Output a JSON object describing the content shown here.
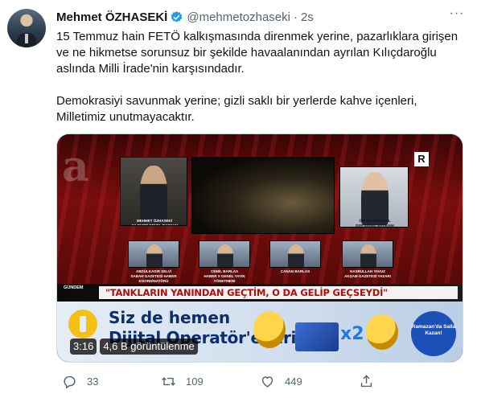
{
  "tweet": {
    "author_name": "Mehmet ÖZHASEKİ",
    "author_handle": "@mehmetozhaseki",
    "separator": "·",
    "time": "2s",
    "more_label": "···",
    "paragraph1": "15 Temmuz hain FETÖ kalkışmasında direnmek yerine, pazarlıklara girişen ve ne hikmetse sorunsuz bir şekilde havaalanından ayrılan Kılıçdaroğlu aslında Milli İrade'nin karşısındadır.",
    "paragraph2": "Demokrasiyi savunmak yerine; gizli saklı bir yerlerde kahve içenleri, Milletimiz unutmayacaktır."
  },
  "media": {
    "duration": "3:16",
    "views": "4,6 B görüntülenme",
    "broadcast": {
      "channel_badge": "R",
      "headline": "\"TANKLARIN YANINDAN GEÇTİM, O DA GELİP GEÇSEYDİ\"",
      "program": "GÜNDEM",
      "captions": {
        "left": "MEHMET ÖZHASEKİ\nAK PARTİ GENEL BAŞKAN YARDIMCISI",
        "right": "ÖNDER AKSAKAL\nDSP GENEL BAŞKANI",
        "g1": "ABDÜLKADİR SELVİ\nSABAH GAZETESİ HABER KOORDİNATÖRÜ",
        "g2": "CEMİL BARLAS\nHABER X GENEL YAYIN YÖNETMENİ",
        "g3": "CANAN BARLAS",
        "g4": "NASRULLAH YAVUZ\nAKŞAM GAZETESİ YAZARI"
      }
    },
    "ad": {
      "line1": "Siz de hemen",
      "line2": "Dijital Operatör'e girin.",
      "multiplier": "x2",
      "badge": "Ramazan'da Salla Kazan!"
    }
  },
  "actions": {
    "reply_count": "33",
    "retweet_count": "109",
    "like_count": "449"
  },
  "colors": {
    "verified": "#1d9bf0",
    "text": "#0f1419",
    "secondary": "#536471",
    "headline_red": "#b10d0d"
  }
}
